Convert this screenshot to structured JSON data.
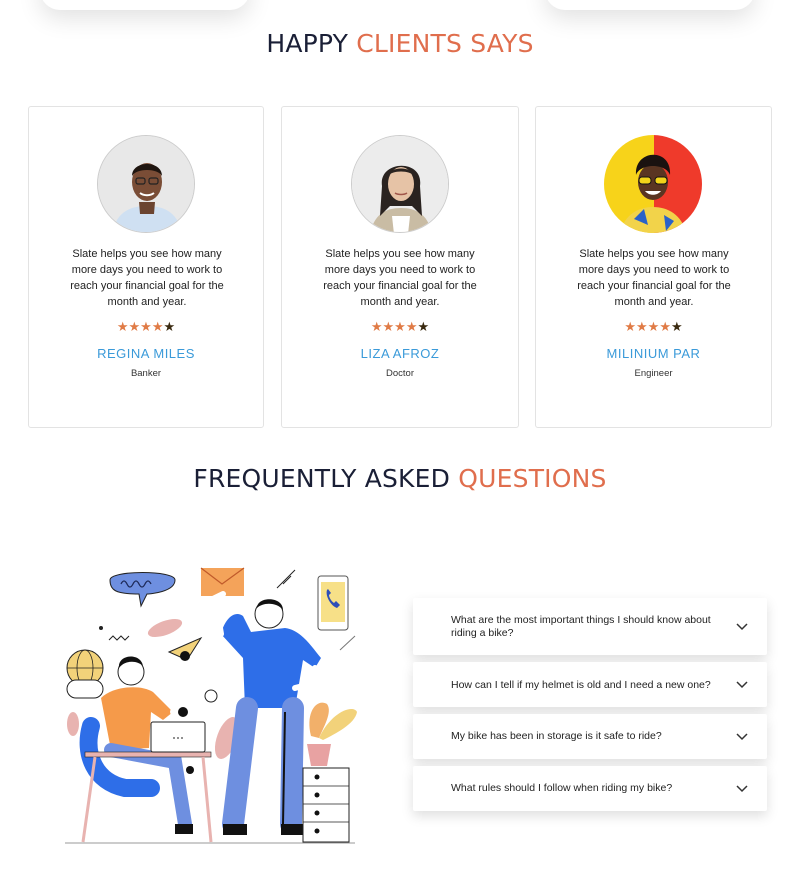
{
  "testimonials": {
    "title_main": "HAPPY",
    "title_accent": "CLIENTS SAYS",
    "items": [
      {
        "quote": "Slate helps you see how many more days you need to work to reach your financial goal for the month and year.",
        "rating": 4,
        "max_rating": 5,
        "name": "REGINA MILES",
        "role": "Banker"
      },
      {
        "quote": "Slate helps you see how many more days you need to work to reach your financial goal for the month and year.",
        "rating": 4,
        "max_rating": 5,
        "name": "LIZA AFROZ",
        "role": "Doctor"
      },
      {
        "quote": "Slate helps you see how many more days you need to work to reach your financial goal for the month and year.",
        "rating": 4,
        "max_rating": 5,
        "name": "MILINIUM PAR",
        "role": "Engineer"
      }
    ]
  },
  "faq": {
    "title_main": "FREQUENTLY ASKED",
    "title_accent": "QUESTIONS",
    "items": [
      {
        "question": "What are the most important things I should know about riding a bike?",
        "icon": "chevron-down-icon"
      },
      {
        "question": "How can I tell if my helmet is old and I need a new one?",
        "icon": "chevron-down-icon"
      },
      {
        "question": "My bike has been in storage is it safe to ride?",
        "icon": "chevron-down-icon"
      },
      {
        "question": "What rules should I follow when riding my bike?",
        "icon": "chevron-down-icon"
      }
    ]
  },
  "colors": {
    "accent": "#e06e4d",
    "name_blue": "#3a9ad9",
    "star": "#e07b46",
    "heading": "#1a1f36"
  }
}
